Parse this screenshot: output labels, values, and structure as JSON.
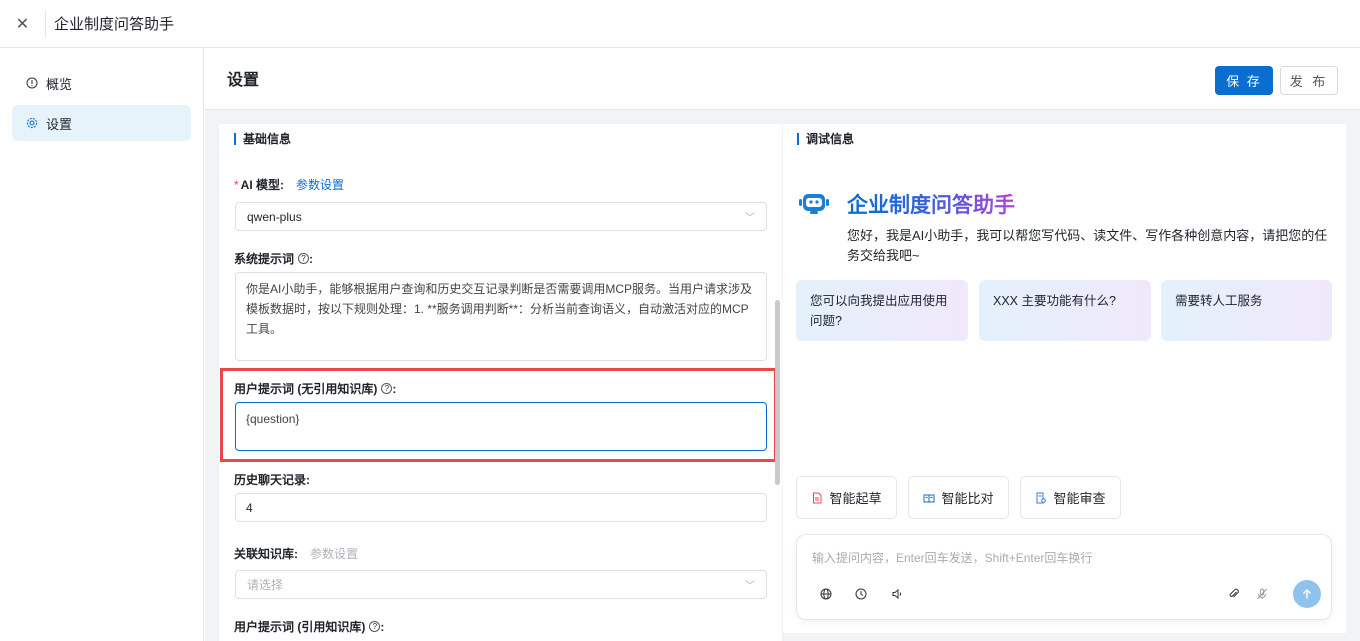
{
  "app": {
    "title": "企业制度问答助手"
  },
  "sidebar": {
    "items": [
      {
        "label": "概览"
      },
      {
        "label": "设置"
      }
    ]
  },
  "header": {
    "title": "设置",
    "save_label": "保 存",
    "publish_label": "发 布"
  },
  "left": {
    "section_title": "基础信息",
    "ai_model": {
      "label": "AI 模型:",
      "link": "参数设置",
      "value": "qwen-plus"
    },
    "system_prompt": {
      "label": "系统提示词",
      "text": "你是AI小助手，能够根据用户查询和历史交互记录判断是否需要调用MCP服务。当用户请求涉及模板数据时，按以下规则处理：1. **服务调用判断**：分析当前查询语义，自动激活对应的MCP工具。"
    },
    "user_prompt_no_kb": {
      "label": "用户提示词 (无引用知识库)",
      "value": "{question}"
    },
    "history": {
      "label": "历史聊天记录:",
      "value": "4"
    },
    "kb": {
      "label": "关联知识库:",
      "link": "参数设置",
      "placeholder": "请选择"
    },
    "user_prompt_kb": {
      "label": "用户提示词 (引用知识库)"
    }
  },
  "right": {
    "section_title": "调试信息",
    "bot_title": "企业制度问答助手",
    "greeting": "您好，我是AI小助手，我可以帮您写代码、读文件、写作各种创意内容，请把您的任务交给我吧~",
    "suggestions": [
      "您可以向我提出应用使用问题?",
      "XXX 主要功能有什么?",
      "需要转人工服务"
    ],
    "chips": [
      "智能起草",
      "智能比对",
      "智能审查"
    ],
    "chat_placeholder": "输入提问内容，Enter回车发送，Shift+Enter回车换行"
  },
  "colors": {
    "accent": "#0a6ed1",
    "highlight": "#e5484d"
  }
}
